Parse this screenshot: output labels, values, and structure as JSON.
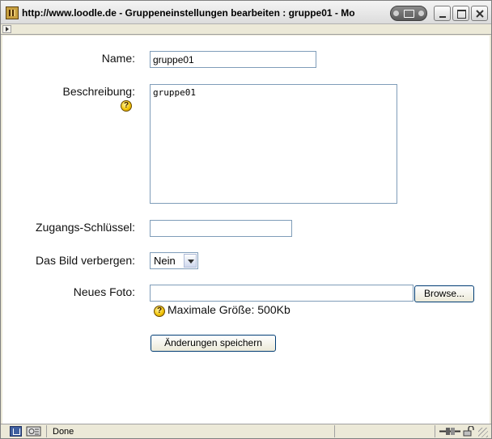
{
  "window": {
    "title": "http://www.loodle.de - Gruppeneinstellungen bearbeiten : gruppe01 - Mo"
  },
  "form": {
    "name_label": "Name:",
    "name_value": "gruppe01",
    "description_label": "Beschreibung:",
    "description_value": "gruppe01",
    "key_label": "Zugangs-Schlüssel:",
    "key_value": "",
    "hide_picture_label": "Das Bild verbergen:",
    "hide_picture_value": "Nein",
    "new_photo_label": "Neues Foto:",
    "new_photo_value": "",
    "browse_label": "Browse...",
    "max_size_text": "Maximale Größe: 500Kb",
    "save_label": "Änderungen speichern",
    "help_glyph": "?"
  },
  "status": {
    "text": "Done"
  },
  "icons": {
    "help": "help-icon",
    "app": "app-icon",
    "close": "close-icon"
  }
}
